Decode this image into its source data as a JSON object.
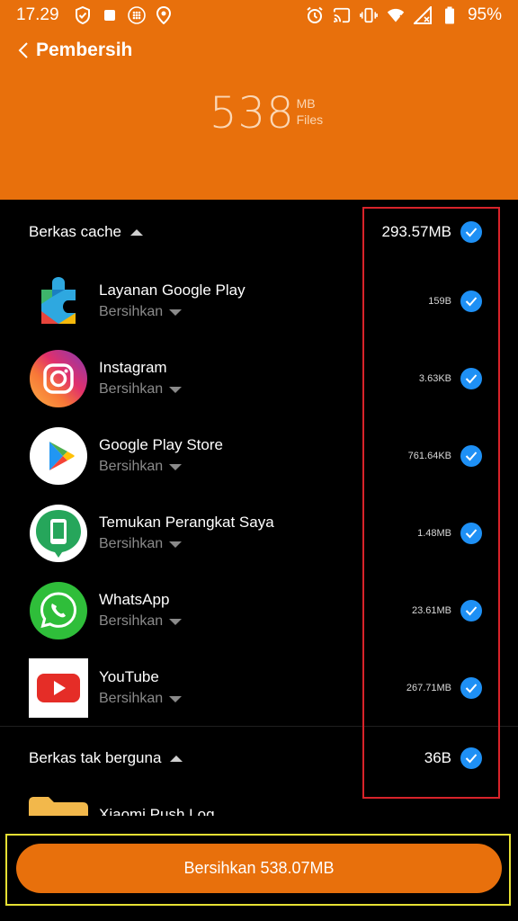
{
  "status_bar": {
    "time": "17.29",
    "battery": "95%",
    "icons_left": [
      "shield-check-icon",
      "stop-icon",
      "dots-grid-icon",
      "location-pin-icon"
    ],
    "icons_right": [
      "alarm-icon",
      "cast-icon",
      "vibrate-icon",
      "wifi-icon",
      "signal-icon",
      "battery-icon"
    ]
  },
  "header": {
    "title": "Pembersih",
    "total_number": "538",
    "total_unit": "MB",
    "total_label": "Files",
    "background_color": "#e8700c"
  },
  "sections": {
    "cache": {
      "title": "Berkas cache",
      "size": "293.57MB",
      "apps": [
        {
          "name": "Layanan Google Play",
          "action": "Bersihkan",
          "size": "159B",
          "icon": "google-play-services-icon"
        },
        {
          "name": "Instagram",
          "action": "Bersihkan",
          "size": "3.63KB",
          "icon": "instagram-icon"
        },
        {
          "name": "Google Play Store",
          "action": "Bersihkan",
          "size": "761.64KB",
          "icon": "google-play-store-icon"
        },
        {
          "name": "Temukan Perangkat Saya",
          "action": "Bersihkan",
          "size": "1.48MB",
          "icon": "find-my-device-icon"
        },
        {
          "name": "WhatsApp",
          "action": "Bersihkan",
          "size": "23.61MB",
          "icon": "whatsapp-icon"
        },
        {
          "name": "YouTube",
          "action": "Bersihkan",
          "size": "267.71MB",
          "icon": "youtube-icon"
        }
      ]
    },
    "junk": {
      "title": "Berkas tak berguna",
      "size": "36B",
      "first_item_partial": "Xiaomi Push Log",
      "first_item_icon": "folder-icon"
    }
  },
  "clean_button": {
    "label": "Bersihkan 538.07MB",
    "color": "#e8700c"
  },
  "accent_check_color": "#1e90f5"
}
